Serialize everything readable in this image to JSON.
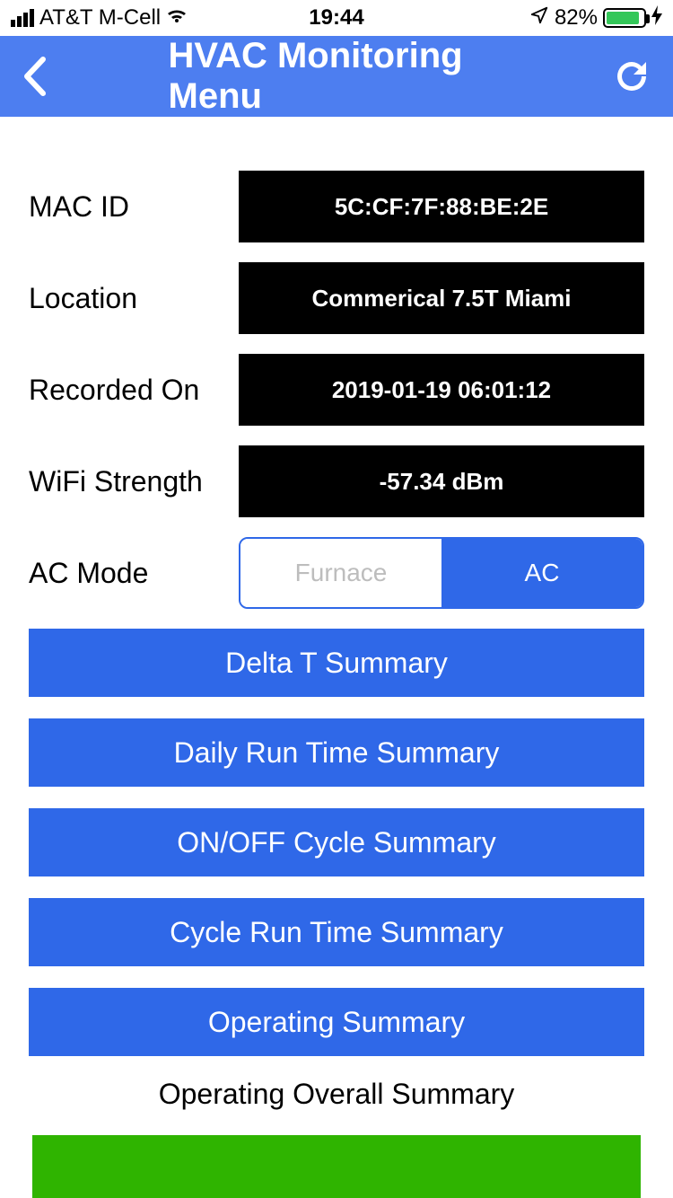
{
  "status": {
    "carrier": "AT&T M-Cell",
    "time": "19:44",
    "battery_pct": "82%"
  },
  "nav": {
    "title": "HVAC Monitoring Menu"
  },
  "info": {
    "mac_label": "MAC ID",
    "mac_value": "5C:CF:7F:88:BE:2E",
    "location_label": "Location",
    "location_value": "Commerical 7.5T Miami",
    "recorded_label": "Recorded On",
    "recorded_value": "2019-01-19 06:01:12",
    "wifi_label": "WiFi Strength",
    "wifi_value": "-57.34 dBm",
    "mode_label": "AC Mode",
    "mode_opt_furnace": "Furnace",
    "mode_opt_ac": "AC"
  },
  "menu": {
    "delta_t": "Delta T Summary",
    "daily_runtime": "Daily Run Time Summary",
    "onoff_cycle": "ON/OFF Cycle Summary",
    "cycle_runtime": "Cycle Run Time Summary",
    "operating": "Operating Summary",
    "overall_title": "Operating Overall Summary"
  }
}
